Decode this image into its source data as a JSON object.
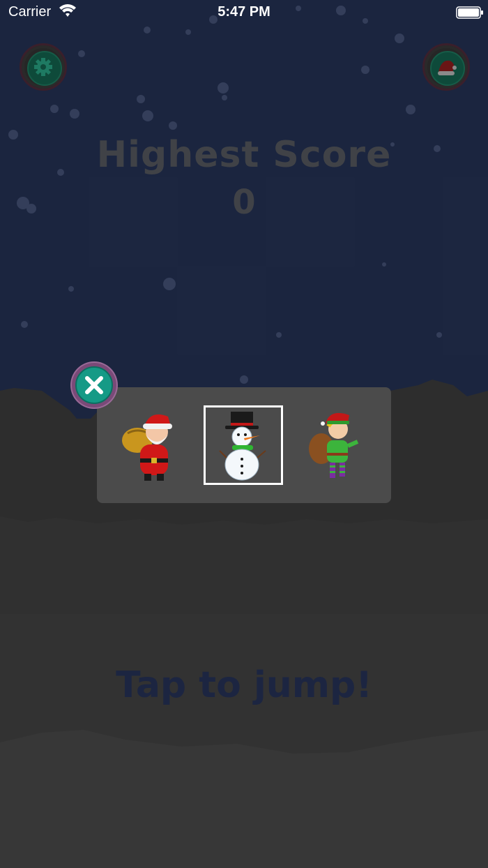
{
  "status_bar": {
    "carrier": "Carrier",
    "time": "5:47 PM",
    "icons": [
      "wifi-icon",
      "battery-icon"
    ]
  },
  "top_bar": {
    "settings_icon": "gear-icon",
    "character_icon": "santa-hat-icon"
  },
  "score": {
    "title": "Highest Score",
    "value": "0"
  },
  "character_picker": {
    "close_icon": "close-icon",
    "characters": [
      {
        "name": "santa",
        "selected": false
      },
      {
        "name": "snowman",
        "selected": true
      },
      {
        "name": "elf",
        "selected": false
      }
    ]
  },
  "prompt": {
    "text": "Tap to jump!"
  },
  "colors": {
    "sky": "#1f2a47",
    "ground": "#3c3c3c",
    "prompt": "#1c2541",
    "accent": "#159a86"
  }
}
